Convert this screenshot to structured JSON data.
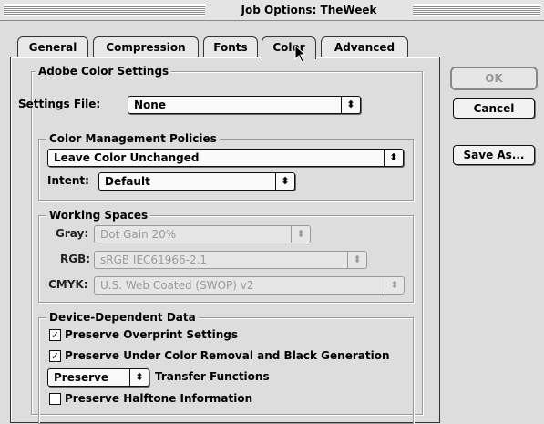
{
  "window": {
    "title": "Job Options: TheWeek"
  },
  "tabs": [
    {
      "label": "General"
    },
    {
      "label": "Compression"
    },
    {
      "label": "Fonts"
    },
    {
      "label": "Color",
      "active": true
    },
    {
      "label": "Advanced"
    }
  ],
  "buttons": {
    "ok": "OK",
    "cancel": "Cancel",
    "save_as": "Save As..."
  },
  "adobe_color_settings": {
    "title": "Adobe Color Settings",
    "settings_file_label": "Settings File:",
    "settings_file_value": "None"
  },
  "color_management_policies": {
    "title": "Color Management Policies",
    "policy_value": "Leave Color Unchanged",
    "intent_label": "Intent:",
    "intent_value": "Default"
  },
  "working_spaces": {
    "title": "Working Spaces",
    "gray_label": "Gray:",
    "gray_value": "Dot Gain 20%",
    "rgb_label": "RGB:",
    "rgb_value": "sRGB IEC61966-2.1",
    "cmyk_label": "CMYK:",
    "cmyk_value": "U.S. Web Coated (SWOP) v2"
  },
  "device_dependent_data": {
    "title": "Device-Dependent Data",
    "preserve_overprint": {
      "label": "Preserve Overprint Settings",
      "checked": true
    },
    "preserve_ucr": {
      "label": "Preserve Under Color Removal and Black Generation",
      "checked": true
    },
    "transfer_popup_value": "Preserve",
    "transfer_label": "Transfer Functions",
    "preserve_halftone": {
      "label": "Preserve Halftone Information",
      "checked": false
    }
  },
  "icons": {
    "popup_arrow": "up-down-arrows-icon",
    "check": "checkmark-icon",
    "cursor": "arrow-cursor-icon"
  }
}
